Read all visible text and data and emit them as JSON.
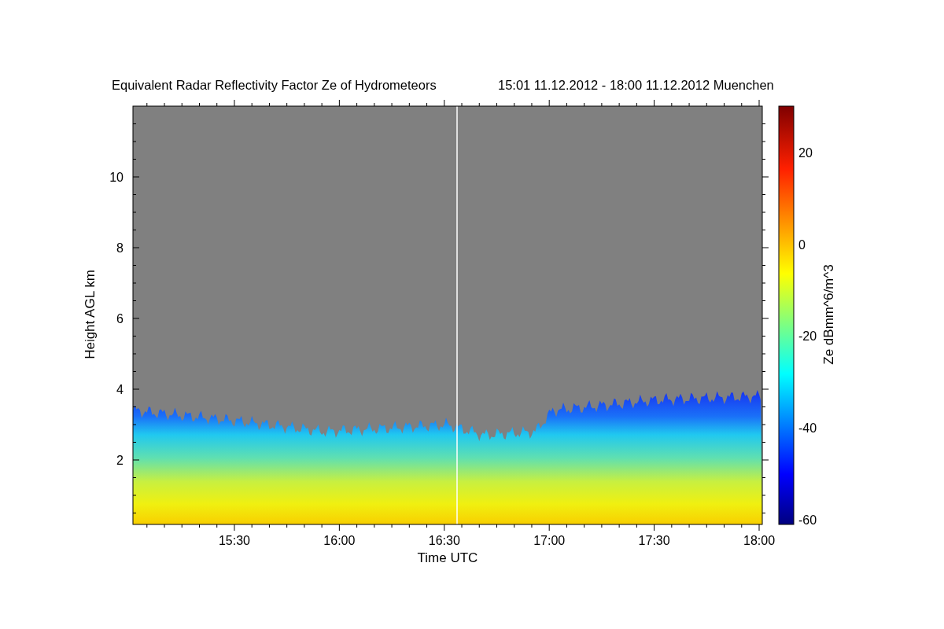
{
  "title": {
    "text": "Equivalent Radar Reflectivity Factor Ze of Hydrometeors",
    "period": "15:01 11.12.2012 - 18:00 11.12.2012 Muenchen"
  },
  "x_axis": {
    "label": "Time UTC",
    "ticks": [
      "15:30",
      "16:00",
      "16:30",
      "17:00",
      "17:30",
      "18:00"
    ]
  },
  "y_axis": {
    "label": "Height AGL km",
    "ticks": [
      "10",
      "8",
      "6",
      "4",
      "2"
    ]
  },
  "colorbar": {
    "label": "Ze dBmm^6/m^3",
    "ticks": [
      "20",
      "0",
      "-20",
      "-40",
      "-60"
    ]
  }
}
